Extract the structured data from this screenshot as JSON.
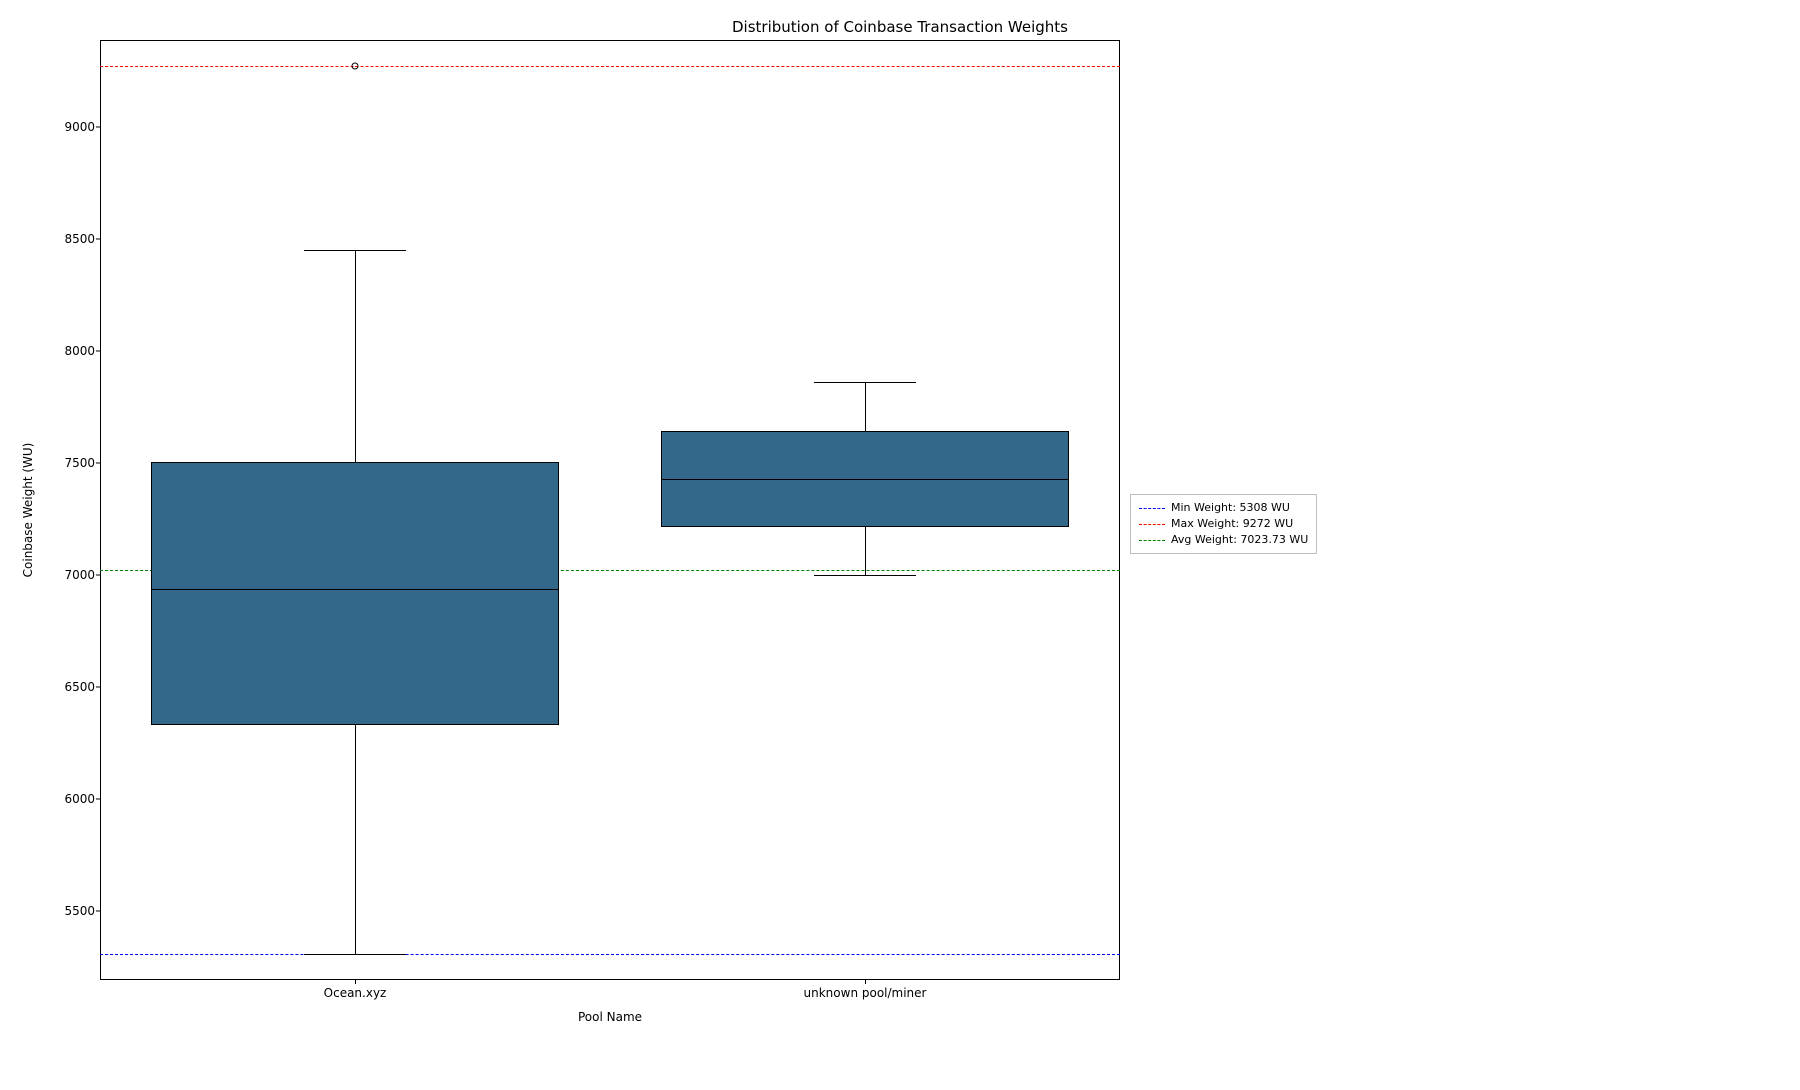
{
  "chart_data": {
    "type": "box",
    "title": "Distribution of Coinbase Transaction Weights",
    "xlabel": "Pool Name",
    "ylabel": "Coinbase Weight (WU)",
    "ylim": [
      5190,
      9390
    ],
    "yticks": [
      5500,
      6000,
      6500,
      7000,
      7500,
      8000,
      8500,
      9000
    ],
    "categories": [
      "Ocean.xyz",
      "unknown pool/miner"
    ],
    "series": [
      {
        "name": "Ocean.xyz",
        "q1": 6330,
        "median": 6935,
        "q3": 7505,
        "whisker_low": 5308,
        "whisker_high": 8450,
        "outliers": [
          9272
        ]
      },
      {
        "name": "unknown pool/miner",
        "q1": 7215,
        "median": 7430,
        "q3": 7645,
        "whisker_low": 7000,
        "whisker_high": 7860,
        "outliers": []
      }
    ],
    "reference_lines": {
      "min": {
        "value": 5308,
        "color": "#0000ff",
        "label": "Min Weight: 5308 WU"
      },
      "max": {
        "value": 9272,
        "color": "#ff0000",
        "label": "Max Weight: 9272 WU"
      },
      "avg": {
        "value": 7023.73,
        "color": "#008000",
        "label": "Avg Weight: 7023.73 WU"
      }
    },
    "legend": [
      {
        "label": "Min Weight: 5308 WU",
        "color": "#0000ff"
      },
      {
        "label": "Max Weight: 9272 WU",
        "color": "#ff0000"
      },
      {
        "label": "Avg Weight: 7023.73 WU",
        "color": "#008000"
      }
    ]
  }
}
